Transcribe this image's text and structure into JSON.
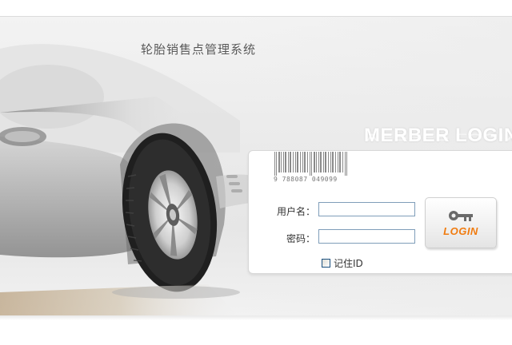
{
  "header": {
    "title": "轮胎销售点管理系统"
  },
  "banner": {
    "heading": "MERBER LOGIN"
  },
  "login_form": {
    "barcode_text": "9 788087 049099",
    "username_label": "用户名：",
    "username_value": "",
    "password_label": "密码：",
    "password_value": "",
    "remember_label": "记住ID",
    "remember_checked": false,
    "login_button_label": "LOGIN",
    "login_button_icon": "key-icon"
  },
  "colors": {
    "login_accent": "#f07b0f",
    "input_border": "#7f9db9"
  }
}
